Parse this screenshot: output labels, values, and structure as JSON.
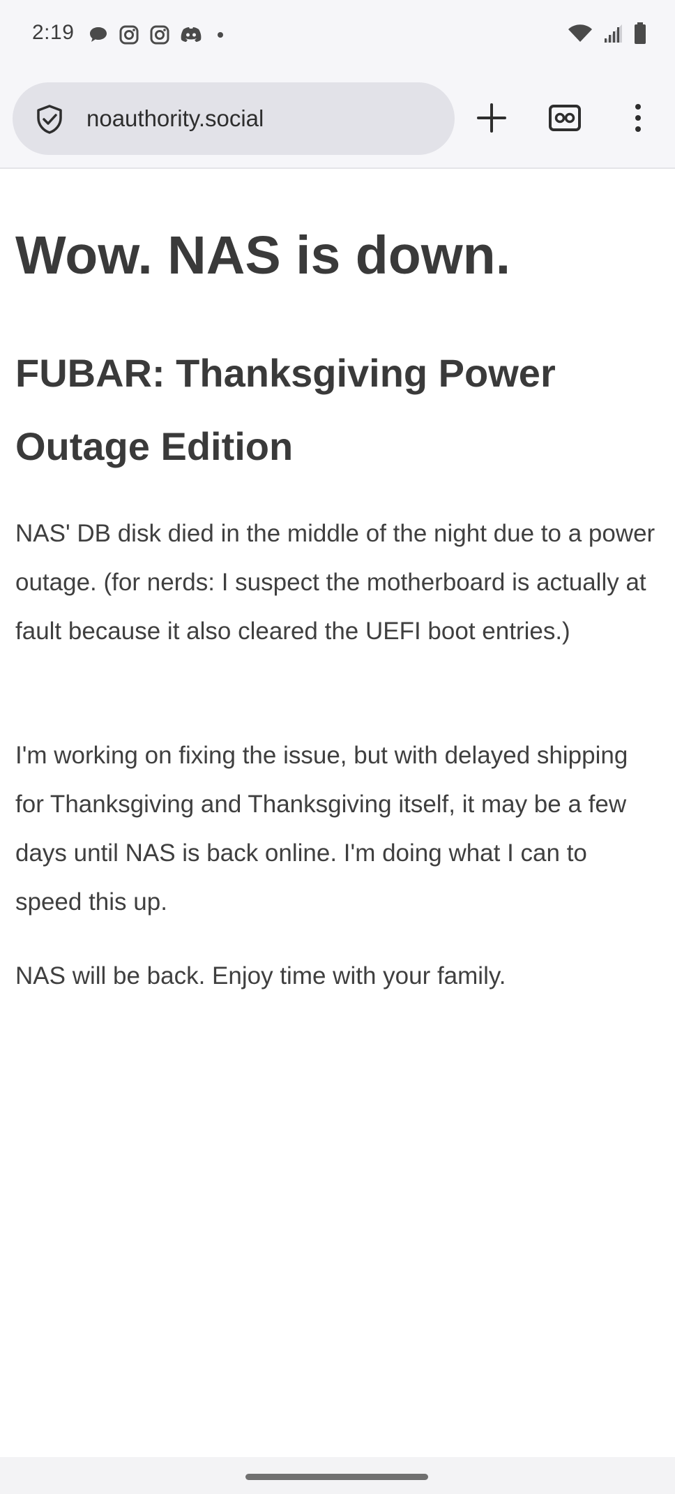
{
  "status_bar": {
    "time": "2:19",
    "left_icons": [
      "chat-bubble-icon",
      "instagram-icon",
      "instagram-icon",
      "discord-icon",
      "dot-icon"
    ],
    "right_icons": [
      "wifi-icon",
      "signal-icon",
      "battery-icon"
    ]
  },
  "browser": {
    "url": "noauthority.social",
    "site_info_icon": "shield-check-icon",
    "new_tab_icon": "plus-icon",
    "tabs_icon": "incognito-tabs-icon",
    "menu_icon": "more-vert-icon"
  },
  "page": {
    "title": "Wow. NAS is down.",
    "subtitle": "FUBAR: Thanksgiving Power Outage Edition",
    "paragraphs": [
      "NAS' DB disk died in the middle of the night due to a power outage. (for nerds: I suspect the motherboard is actually at fault because it also cleared the UEFI boot entries.)",
      "I'm working on fixing the issue, but with delayed shipping for Thanksgiving and Thanksgiving itself, it may be a few days until NAS is back online. I'm doing what I can to speed this up.",
      "NAS will be back. Enjoy time with your family."
    ]
  }
}
